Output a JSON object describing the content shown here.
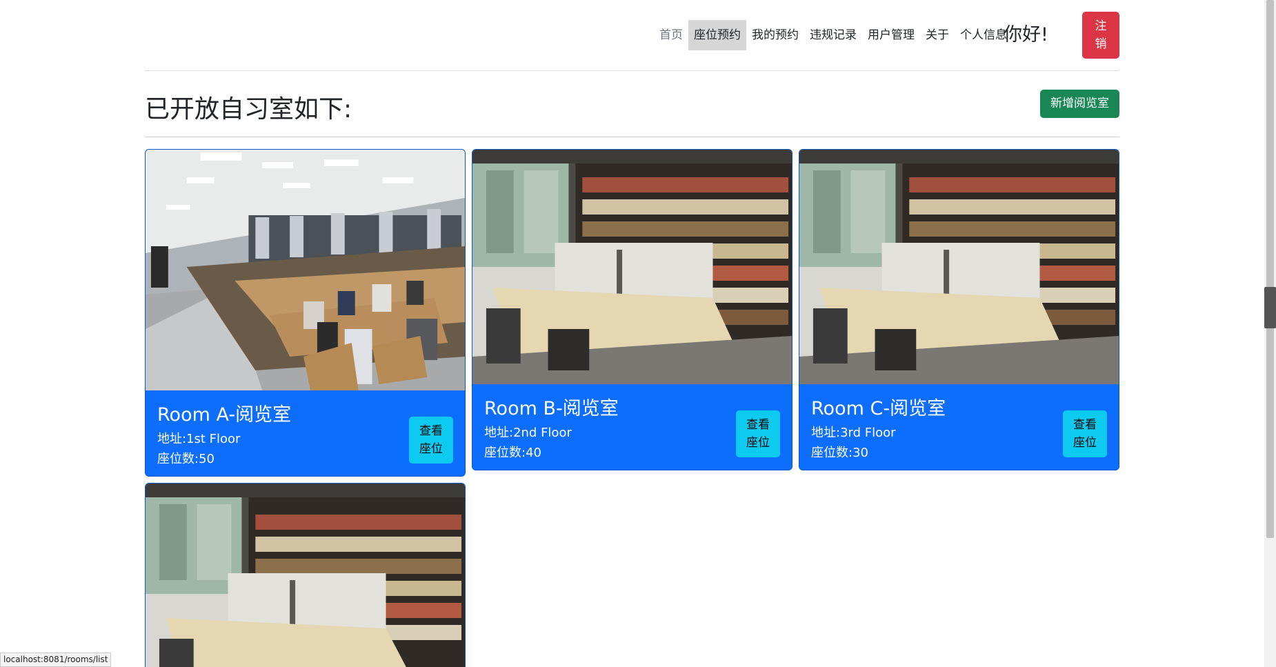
{
  "nav": {
    "items": [
      {
        "label": "首页"
      },
      {
        "label": "座位预约"
      },
      {
        "label": "我的预约"
      },
      {
        "label": "违规记录"
      },
      {
        "label": "用户管理"
      },
      {
        "label": "关于"
      },
      {
        "label": "个人信息"
      }
    ],
    "greeting": "你好!",
    "logout_label": "注销"
  },
  "main": {
    "title": "已开放自习室如下:",
    "add_room_label": "新增阅览室"
  },
  "rooms": [
    {
      "name": "Room A-阅览室",
      "address": "地址:1st Floor",
      "seats": "座位数:50",
      "button": "查看座位"
    },
    {
      "name": "Room B-阅览室",
      "address": "地址:2nd Floor",
      "seats": "座位数:40",
      "button": "查看座位"
    },
    {
      "name": "Room C-阅览室",
      "address": "地址:3rd Floor",
      "seats": "座位数:30",
      "button": "查看座位"
    }
  ],
  "status_bar": {
    "url": "localhost:8081/rooms/list"
  },
  "colors": {
    "card": "#0d6efd",
    "view_button": "#0dcaf0",
    "add_button": "#198754",
    "logout_button": "#dc3545"
  }
}
